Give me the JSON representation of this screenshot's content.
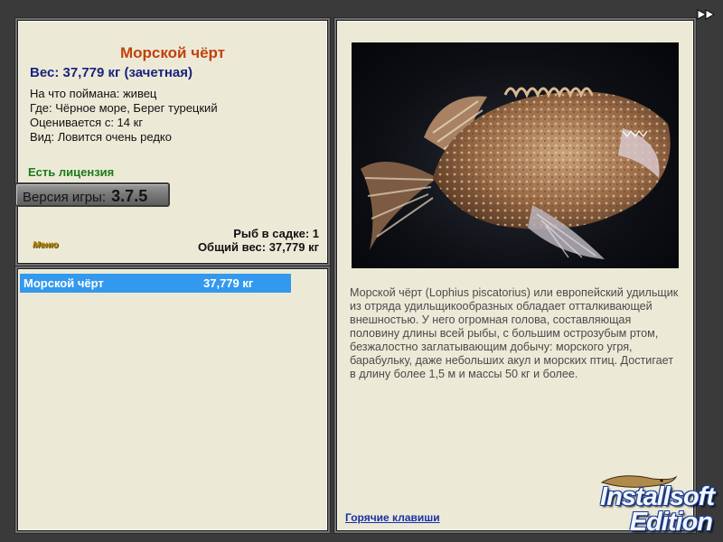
{
  "info": {
    "fish_name": "Морской чёрт",
    "weight_line": "Вес: 37,779 кг (зачетная)",
    "bait": "На что поймана: живец",
    "location": "Где: Чёрное море, Берег турецкий",
    "min_weight": "Оценивается с: 14 кг",
    "rarity": "Вид: Ловится очень редко",
    "license": "Есть лицензия",
    "version_label": "Версия игры:",
    "version_number": "3.7.5",
    "menu_label": "Меню",
    "fish_in_keepnet": "Рыб в садке: 1",
    "total_weight": "Общий вес: 37,779 кг"
  },
  "catch_list": [
    {
      "name": "Морской чёрт",
      "weight": "37,779 кг",
      "selected": true
    }
  ],
  "description": {
    "photo_subject": "anglerfish-photo",
    "text": "Морской чёрт (Lophius piscatorius) или европейский удильщик из отряда удильщикообразных обладает отталкивающей внешностью. У него огромная голова, составляющая половину длины всей рыбы, с большим острозубым ртом, безжалостно заглатывающим добычу: морского угря, барабульку, даже небольших акул и морских птиц. Достигает в длину более 1,5 м и массы 50 кг и более.",
    "hotkeys_link": "Горячие клавиши"
  },
  "watermark": {
    "line1": "Installsoft",
    "line2": "Edition"
  },
  "colors": {
    "panel_bg": "#ecead7",
    "title": "#c2410c",
    "weight": "#1a237e",
    "license": "#1b7a1b",
    "selection": "#3399ee",
    "link": "#1a2fa8"
  }
}
